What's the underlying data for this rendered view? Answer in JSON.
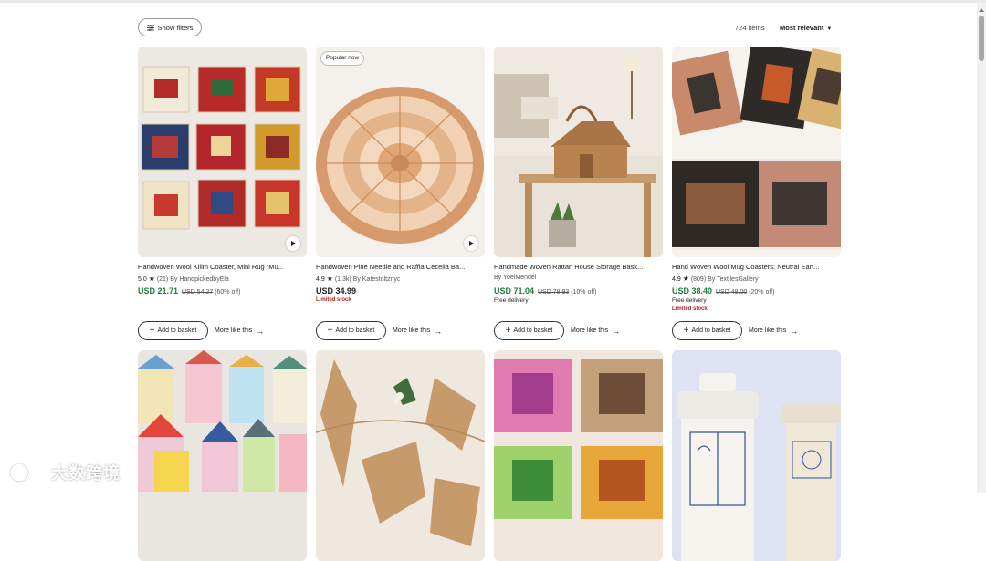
{
  "toolbar": {
    "filters_label": "Show filters",
    "items_count": "724 items",
    "sort_label": "Most relevant"
  },
  "products": [
    {
      "title": "Handwoven Wool Kilim Coaster, Mini Rug “Mu...",
      "rating": "5.0",
      "reviews": "(21)",
      "shop": "By HandpickedbyEla",
      "price": "USD 21.71",
      "original_price": "USD 54.27",
      "discount": "(60% off)",
      "badge": "",
      "shipping": "",
      "stock": "",
      "add_label": "Add to basket",
      "more_label": "More like this"
    },
    {
      "title": "Handwoven Pine Needle and Raffia Cecelia Ba...",
      "rating": "4.9",
      "reviews": "(1.3k)",
      "shop": "By Katestoltznyc",
      "price": "USD 34.99",
      "original_price": "",
      "discount": "",
      "badge": "Popular now",
      "shipping": "",
      "stock": "Limited stock",
      "add_label": "Add to basket",
      "more_label": "More like this"
    },
    {
      "title": "Handmade Woven Rattan House Storage Bask...",
      "rating": "",
      "reviews": "",
      "shop": "By YoelMendel",
      "price": "USD 71.04",
      "original_price": "USD 78.93",
      "discount": "(10% off)",
      "badge": "",
      "shipping": "Free delivery",
      "stock": "",
      "add_label": "Add to basket",
      "more_label": "More like this"
    },
    {
      "title": "Hand Woven Wool Mug Coasters: Neutral Eart...",
      "rating": "4.9",
      "reviews": "(809)",
      "shop": "By TextilesGallery",
      "price": "USD 38.40",
      "original_price": "USD 48.00",
      "discount": "(20% off)",
      "badge": "",
      "shipping": "Free delivery",
      "stock": "Limited stock",
      "add_label": "Add to basket",
      "more_label": "More like this"
    }
  ],
  "watermark": "大数跨境",
  "colors": {
    "sale_price": "#1e7b3c",
    "limited_stock": "#b3261e"
  }
}
